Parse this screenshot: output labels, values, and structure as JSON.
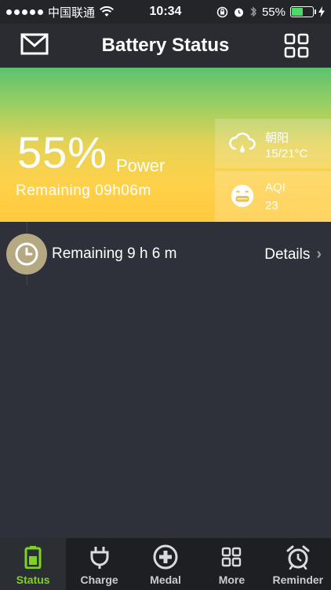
{
  "status_bar": {
    "carrier": "中国联通",
    "time": "10:34",
    "battery_percent": "55%",
    "battery_level": 0.55
  },
  "header": {
    "title": "Battery Status",
    "left_icon": "mail-icon",
    "right_icon": "grid-icon"
  },
  "hero": {
    "percent": "55%",
    "power_label": "Power",
    "remaining": "Remaining 09h06m"
  },
  "weather": {
    "city": "朝阳",
    "temp": "15/21°C",
    "aqi_label": "AQI",
    "aqi_value": "23"
  },
  "timeline": {
    "remaining": "Remaining 9 h 6 m",
    "details": "Details"
  },
  "tabs": [
    {
      "label": "Status",
      "icon": "battery-icon",
      "active": true
    },
    {
      "label": "Charge",
      "icon": "plug-icon",
      "active": false
    },
    {
      "label": "Medal",
      "icon": "plus-circle-icon",
      "active": false
    },
    {
      "label": "More",
      "icon": "grid-icon",
      "active": false
    },
    {
      "label": "Reminder",
      "icon": "alarm-clock-icon",
      "active": false
    }
  ],
  "colors": {
    "accent_green": "#7ed321",
    "background": "#2e3139",
    "clock_badge": "#b5a983"
  }
}
